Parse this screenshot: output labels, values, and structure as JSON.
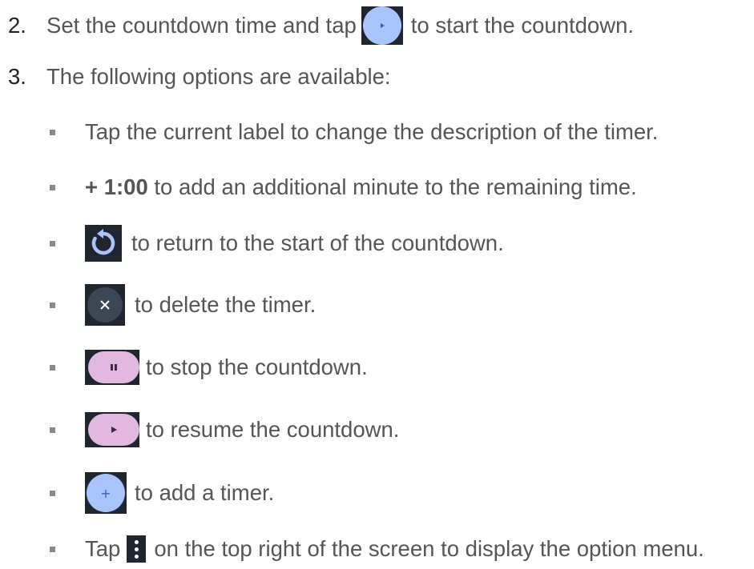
{
  "steps": [
    {
      "number": "2.",
      "text_before": "Set the countdown time and tap",
      "icon": "start-countdown-icon",
      "text_after": "to start the countdown."
    },
    {
      "number": "3.",
      "text": "The following options are available:"
    }
  ],
  "options": {
    "label_item": "Tap the current label to change the description of the timer.",
    "add_minute_bold": "+ 1:00",
    "add_minute_rest": "to add an additional minute to the remaining time.",
    "reset_text": "to return to the start of the countdown.",
    "delete_text": "to delete the timer.",
    "stop_text": "to stop the countdown.",
    "resume_text": "to resume the countdown.",
    "add_timer_text": "to add a timer.",
    "add_timer_glyph": "+",
    "menu_before": "Tap",
    "menu_after": "on the top right of the screen to display the option menu."
  },
  "icons": {
    "start": "play-icon",
    "reset": "reset-icon",
    "delete": "close-icon",
    "stop": "pause-icon",
    "resume": "play-icon",
    "add": "plus-icon",
    "menu": "more-vertical-icon"
  },
  "colors": {
    "text": "#555555",
    "number": "#222222",
    "bullet": "#8a8a8a",
    "icon_bg": "#1f2630",
    "blue_button": "#a9c3fb",
    "pink_button": "#e2b8e0",
    "reset_blue": "#a9c3fb"
  }
}
